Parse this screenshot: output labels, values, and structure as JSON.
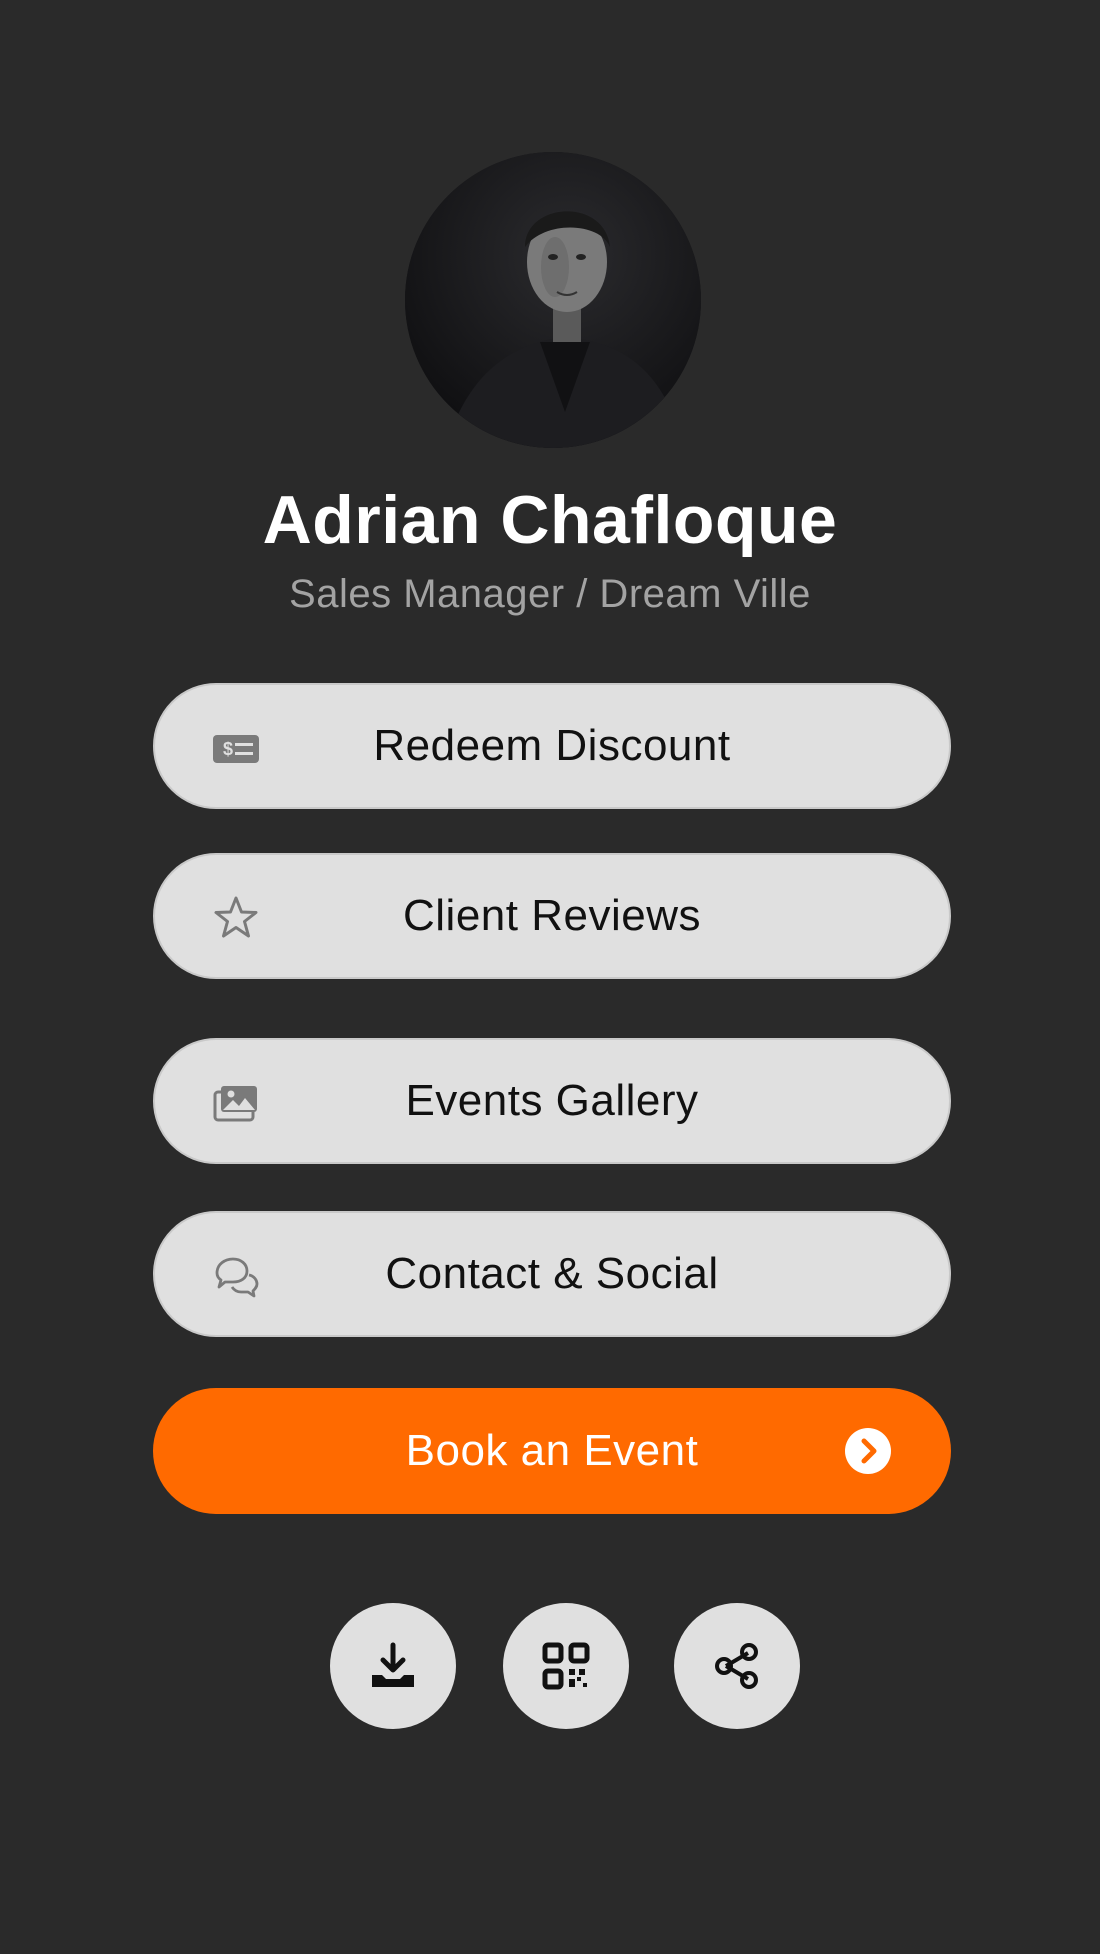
{
  "profile": {
    "name": "Adrian Chafloque",
    "subtitle": "Sales Manager / Dream Ville",
    "avatar_icon": "profile-photo"
  },
  "menu": [
    {
      "label": "Redeem Discount",
      "icon": "discount-card-icon"
    },
    {
      "label": "Client Reviews",
      "icon": "star-icon"
    },
    {
      "label": "Events Gallery",
      "icon": "gallery-icon"
    },
    {
      "label": "Contact & Social",
      "icon": "chat-bubbles-icon"
    }
  ],
  "cta": {
    "label": "Book an Event",
    "icon": "chevron-right-circle-icon",
    "color": "#ff6a00"
  },
  "actions": [
    {
      "name": "download",
      "icon": "download-icon"
    },
    {
      "name": "qr-code",
      "icon": "qr-code-icon"
    },
    {
      "name": "share",
      "icon": "share-icon"
    }
  ],
  "colors": {
    "background": "#2a2a2a",
    "button": "#e0e0e0",
    "accent": "#ff6a00",
    "subtitle": "#a3a3a3"
  }
}
